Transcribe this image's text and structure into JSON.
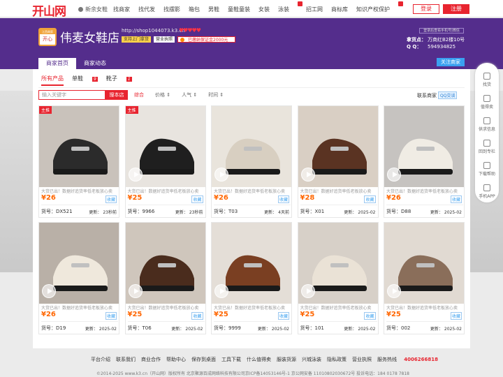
{
  "site": {
    "logo": "开山网",
    "city": "新余女鞋"
  },
  "nav": [
    "找商家",
    "找代发",
    "找摆影",
    "箱包",
    "男鞋",
    "童鞋童装",
    "女装",
    "泳装",
    "招工网",
    "商标库",
    "知识产权保护"
  ],
  "auth": {
    "login": "登录",
    "register": "注册"
  },
  "shop": {
    "logo_top": "江西商家",
    "logo_mark": "开心",
    "name": "伟麦女鞋店",
    "url": "http://shop1044073.k3.cn",
    "hearts": "♥♥♥♥♥",
    "badges": [
      "支持上门拿货",
      "营业执照",
      "已缴纳保证金2000元"
    ],
    "follow_phone": "登录后查看手机号|微信",
    "addr_label": "拿货点：",
    "addr_value": "万商红B2楼10号",
    "qq_label": "Q Q：",
    "qq_value": "594934825"
  },
  "tabs": [
    "商家首页",
    "商家动态"
  ],
  "follow_btn": "关注商家",
  "categories": [
    {
      "label": "所有产品",
      "count": ""
    },
    {
      "label": "单鞋",
      "count": "9"
    },
    {
      "label": "靴子",
      "count": "1"
    }
  ],
  "search": {
    "placeholder": "输入关键字",
    "button": "搜本店"
  },
  "sort": [
    "综合",
    "价格 ⇕",
    "人气 ⇕",
    "时间 ⇕"
  ],
  "contact": {
    "label": "联系商家",
    "qq": "QQ交谈"
  },
  "desc": "大货已出！数据好追货率低老板放心卖",
  "fav": "收藏",
  "code_label": "货号：",
  "upd_label": "更新：",
  "products": [
    {
      "tag": "主推",
      "price": "¥26",
      "code": "DX521",
      "upd": "23秒前"
    },
    {
      "tag": "主推",
      "price": "¥25",
      "code": "9966",
      "upd": "23秒前"
    },
    {
      "tag": "",
      "price": "¥26",
      "code": "T03",
      "upd": "4天前"
    },
    {
      "tag": "",
      "price": "¥28",
      "code": "X01",
      "upd": "2025-02"
    },
    {
      "tag": "",
      "price": "¥26",
      "code": "D88",
      "upd": "2025-02"
    },
    {
      "tag": "",
      "price": "¥26",
      "code": "D19",
      "upd": "2025-02"
    },
    {
      "tag": "",
      "price": "¥25",
      "code": "T06",
      "upd": "2025-02"
    },
    {
      "tag": "",
      "price": "¥25",
      "code": "9999",
      "upd": "2025-02"
    },
    {
      "tag": "",
      "price": "¥25",
      "code": "101",
      "upd": "2025-02"
    },
    {
      "tag": "",
      "price": "¥25",
      "code": "002",
      "upd": "2025-02"
    }
  ],
  "footer": {
    "links": [
      "平台介绍",
      "联系我们",
      "商业合作",
      "帮助中心",
      "保存到桌面",
      "工具下载",
      "什么值得卖",
      "服装货源",
      "兴城泳装",
      "隐私政策",
      "营业执照"
    ],
    "hotline_label": "服务热线",
    "hotline": "4006266818",
    "copyright": "©2014-2025 www.k3.cn（开山网）版权所有 北京聚源百成网络科技有限公司京ICP备14053146号-1 京公网安备 11010802030672号 投诉电话：184 0178 7818"
  },
  "sidebar": [
    "找货",
    "值得卖",
    "供求信息",
    "回到专栏",
    "下载帮助",
    "手机APP"
  ]
}
